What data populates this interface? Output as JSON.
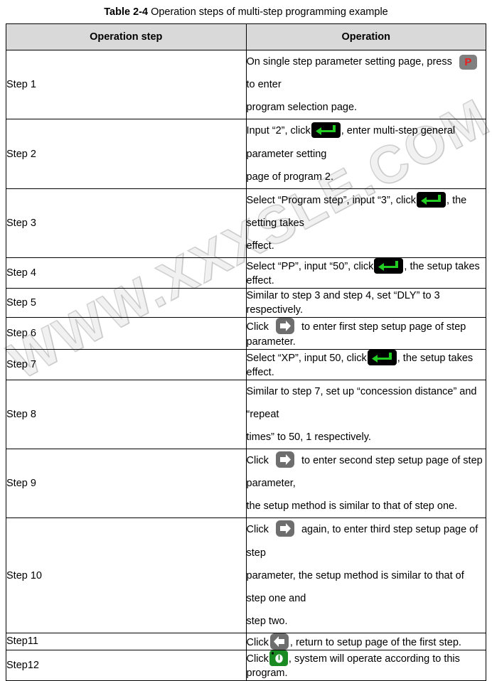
{
  "caption": {
    "number": "Table 2-4",
    "text": " Operation steps of multi-step programming example"
  },
  "watermark": {
    "text": "WWW.XXXSLE.COM"
  },
  "table": {
    "headers": {
      "step": "Operation step",
      "operation": "Operation"
    },
    "rows": [
      {
        "step": "Step 1",
        "line1_a": "On single step parameter setting page, press ",
        "icon": "program-key-icon",
        "line1_b": " to enter",
        "line2": "program selection page."
      },
      {
        "step": "Step 2",
        "line1_a": "Input “2”, click",
        "icon": "enter-key-icon",
        "line1_b": ", enter multi-step general parameter setting",
        "line2": "page of program 2."
      },
      {
        "step": "Step 3",
        "line1_a": "Select “Program step”, input “3”, click",
        "icon": "enter-key-icon",
        "line1_b": ", the setting takes",
        "line2": "effect."
      },
      {
        "step": "Step 4",
        "line1_a": "Select “PP”, input “50”, click",
        "icon": "enter-key-icon",
        "line1_b": ", the setup takes effect.",
        "line2": ""
      },
      {
        "step": "Step 5",
        "line1_a": "Similar to step 3 and step 4, set “DLY” to 3 respectively.",
        "icon": "",
        "line1_b": "",
        "line2": ""
      },
      {
        "step": "Step 6",
        "line1_a": "Click ",
        "icon": "right-arrow-key-icon",
        "line1_b": " to enter first step setup page of step parameter.",
        "line2": ""
      },
      {
        "step": "Step 7",
        "line1_a": "Select “XP”, input 50, click",
        "icon": "enter-key-icon",
        "line1_b": ", the setup takes effect.",
        "line2": ""
      },
      {
        "step": "Step 8",
        "line1_a": "Similar to step 7, set up “concession distance” and “repeat",
        "icon": "",
        "line1_b": "",
        "line2": "times” to 50, 1 respectively."
      },
      {
        "step": "Step 9",
        "line1_a": "Click ",
        "icon": "right-arrow-key-icon",
        "line1_b": " to enter second step setup page of step parameter,",
        "line2": "the setup method is similar to that of step one."
      },
      {
        "step": "Step 10",
        "line1_a": "Click ",
        "icon": "right-arrow-key-icon",
        "line1_b": " again, to enter third step setup page of step",
        "line2": "parameter, the setup method is similar to that of step one and",
        "line3": "step two."
      },
      {
        "step": "Step11",
        "line1_a": "Click",
        "icon": "left-arrow-key-icon",
        "line1_b": ", return to setup page of the first step.",
        "line2": ""
      },
      {
        "step": "Step12",
        "line1_a": "Click",
        "icon": "run-key-icon",
        "line1_b": ", system will operate according to this program.",
        "line2": ""
      }
    ]
  },
  "icons": {
    "program_key_label": "P"
  },
  "colors": {
    "header_fill": "#d9d9d9",
    "border": "#000000",
    "program_key_bg": "#808080",
    "program_key_fg": "#e8201f",
    "enter_key_bg": "#000000",
    "enter_arrow": "#22cc22",
    "arrow_key_bg": "#6e6e6e",
    "run_key_bg": "#1a8a22"
  }
}
